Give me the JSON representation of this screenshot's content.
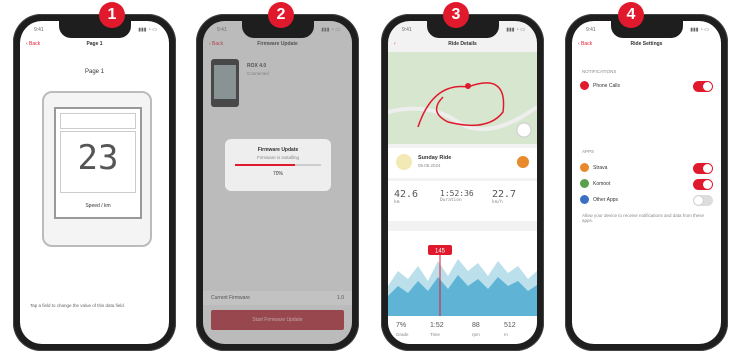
{
  "steps": [
    "1",
    "2",
    "3",
    "4"
  ],
  "phone1": {
    "time": "9:41",
    "back": "‹ Back",
    "title": "Page 1",
    "heading": "Page 1",
    "digits": "23",
    "device_label": "Speed / km",
    "footer_text": "Tap a field to change the value of this data field."
  },
  "phone2": {
    "time": "9:41",
    "back": "‹ Back",
    "title": "Firmware Update",
    "device_name": "ROX 4.0",
    "device_sub": "Connected",
    "dialog_title": "Firmware Update",
    "dialog_sub": "Firmware is installing",
    "dialog_progress": 0.7,
    "dialog_percent": "70%",
    "current_label": "Current Firmware",
    "current_value": "1.0",
    "start_button": "Start Firmware Update"
  },
  "phone3": {
    "time": "9:41",
    "title": "Ride Details",
    "activity_title": "Sunday Ride",
    "activity_sub": "05.05.2024",
    "stats": [
      {
        "value": "42.6",
        "label": "km"
      },
      {
        "value": "1:52:36",
        "label": "Duration"
      },
      {
        "value": "22.7",
        "label": "km/h"
      }
    ],
    "chart_badge": "145",
    "bottom_stats": [
      {
        "value": "7%",
        "label": "Grade"
      },
      {
        "value": "1:52",
        "label": "Time"
      },
      {
        "value": "88",
        "label": "rpm"
      },
      {
        "value": "512",
        "label": "m"
      }
    ]
  },
  "phone4": {
    "time": "9:41",
    "back": "‹ Back",
    "title": "Ride Settings",
    "section1": "NOTIFICATIONS",
    "section2": "APPS",
    "items": [
      {
        "label": "Phone Calls",
        "on": true,
        "color": "#e1192d"
      },
      {
        "label": "Strava",
        "on": true,
        "color": "#e8892b"
      },
      {
        "label": "Komoot",
        "on": true,
        "color": "#5aa04a"
      },
      {
        "label": "Other Apps",
        "on": false,
        "color": "#3a6fc4"
      }
    ],
    "note": "Allow your device to receive notifications and data from these apps."
  },
  "colors": {
    "accent": "#e1192d",
    "dark_red": "#b5202c"
  }
}
